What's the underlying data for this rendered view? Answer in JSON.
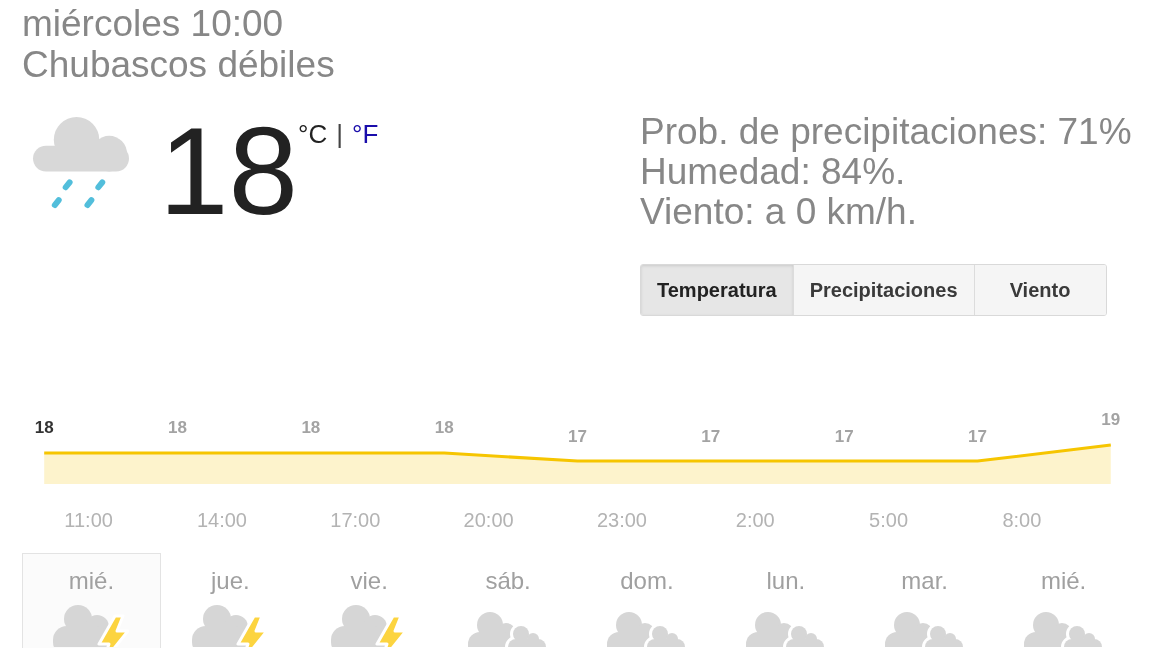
{
  "header": {
    "datetime": "miércoles 10:00",
    "condition": "Chubascos débiles"
  },
  "current": {
    "temperature": "18",
    "units": [
      {
        "label": "°C",
        "selected": true
      },
      {
        "label": "°F",
        "selected": false
      }
    ],
    "unit_separator": "|"
  },
  "details": [
    "Prob. de precipitaciones: 71%",
    "Humedad: 84%.",
    "Viento: a 0 km/h."
  ],
  "tabs": [
    {
      "label": "Temperatura",
      "selected": true
    },
    {
      "label": "Precipitaciones",
      "selected": false
    },
    {
      "label": "Viento",
      "selected": false
    }
  ],
  "hourly_chart": {
    "chart_data": {
      "type": "area",
      "categories": [
        null,
        "11:00",
        null,
        null,
        "14:00",
        null,
        null,
        "17:00",
        null,
        null,
        "20:00",
        null,
        null,
        "23:00",
        null,
        null,
        "2:00",
        null,
        null,
        "5:00",
        null,
        null,
        "8:00",
        null,
        null
      ],
      "series": [
        {
          "color": "#f6c500",
          "values": [
            18,
            null,
            null,
            18,
            null,
            null,
            18,
            null,
            null,
            18,
            null,
            null,
            17,
            null,
            null,
            17,
            null,
            null,
            17,
            null,
            null,
            17,
            null,
            null,
            19
          ]
        }
      ],
      "data_labels": true
    },
    "label_states": [
      {
        "selected": true
      },
      {
        "selected": false
      },
      {
        "selected": false
      },
      {
        "selected": false
      },
      {
        "selected": false
      },
      {
        "selected": false
      },
      {
        "selected": false
      },
      {
        "selected": false
      },
      {
        "selected": false
      }
    ]
  },
  "days": [
    {
      "label": "mié.",
      "selected": true,
      "kind": "storm"
    },
    {
      "label": "jue.",
      "selected": false,
      "kind": "storm"
    },
    {
      "label": "vie.",
      "selected": false,
      "kind": "storm"
    },
    {
      "label": "sáb.",
      "selected": false,
      "kind": "cloudy"
    },
    {
      "label": "dom.",
      "selected": false,
      "kind": "cloudy"
    },
    {
      "label": "lun.",
      "selected": false,
      "kind": "cloudy"
    },
    {
      "label": "mar.",
      "selected": false,
      "kind": "cloudy"
    },
    {
      "label": "mié.",
      "selected": false,
      "kind": "cloudy"
    }
  ]
}
